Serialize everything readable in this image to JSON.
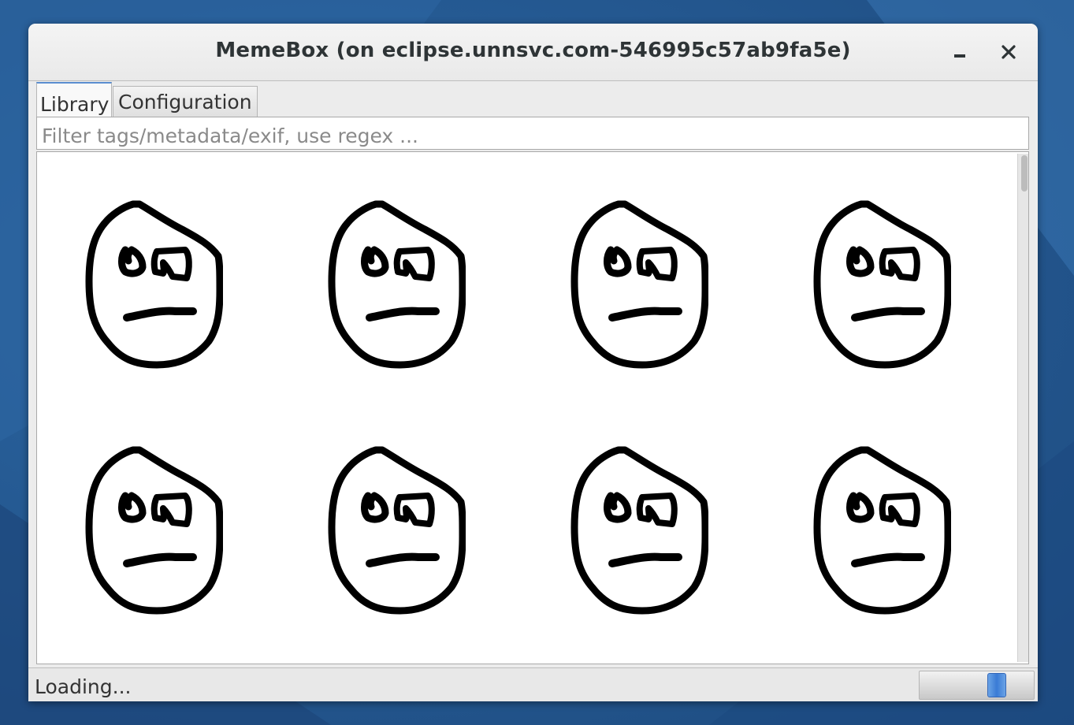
{
  "window": {
    "title": "MemeBox (on eclipse.unnsvc.com-546995c57ab9fa5e)"
  },
  "controls": {
    "minimize_icon": "minimize-icon",
    "close_icon": "close-icon"
  },
  "tabs": [
    {
      "label": "Library",
      "active": true
    },
    {
      "label": "Configuration",
      "active": false
    }
  ],
  "filter": {
    "placeholder": "Filter tags/metadata/exif, use regex ...",
    "value": ""
  },
  "library": {
    "thumbnail_icon": "meh-face-icon",
    "thumbnail_count": 8
  },
  "status": {
    "text": "Loading...",
    "progress": "indeterminate"
  },
  "colors": {
    "accent": "#3a7bd5",
    "desktop": "#255a93"
  }
}
